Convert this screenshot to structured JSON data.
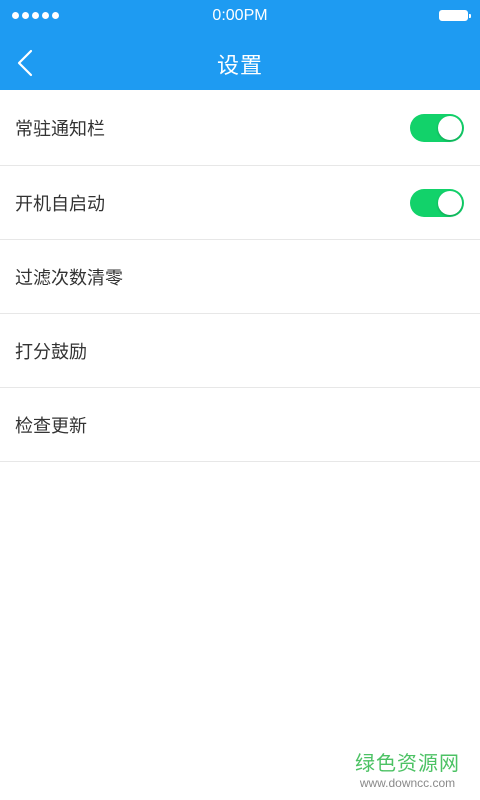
{
  "status_bar": {
    "time": "0:00PM",
    "signal_dots": 5
  },
  "header": {
    "title": "设置",
    "back_icon": "chevron-left-icon",
    "background_color": "#1e9bf2"
  },
  "settings": {
    "items": [
      {
        "label": "常驻通知栏",
        "has_toggle": true,
        "toggle_on": true
      },
      {
        "label": "开机自启动",
        "has_toggle": true,
        "toggle_on": true
      },
      {
        "label": "过滤次数清零",
        "has_toggle": false
      },
      {
        "label": "打分鼓励",
        "has_toggle": false
      },
      {
        "label": "检查更新",
        "has_toggle": false
      }
    ],
    "toggle_on_color": "#12d26a"
  },
  "watermark": {
    "title": "绿色资源网",
    "url": "www.downcc.com"
  }
}
